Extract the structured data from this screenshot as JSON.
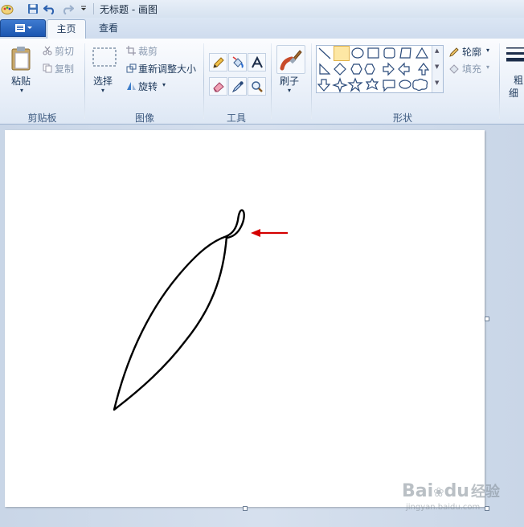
{
  "window": {
    "title": "无标题 - 画图"
  },
  "tabs": [
    {
      "label": "主页",
      "active": true
    },
    {
      "label": "查看",
      "active": false
    }
  ],
  "ribbon": {
    "clipboard": {
      "paste": "粘贴",
      "cut": "剪切",
      "copy": "复制",
      "group": "剪贴板"
    },
    "image": {
      "select": "选择",
      "crop": "裁剪",
      "resize": "重新调整大小",
      "rotate": "旋转",
      "group": "图像"
    },
    "tools": {
      "group": "工具"
    },
    "brushes": {
      "label": "刷子"
    },
    "shapes": {
      "outline": "轮廓",
      "fill": "填充",
      "group": "形状"
    },
    "size": {
      "label_top": "粗",
      "label_bottom": "细"
    }
  },
  "colors": {
    "accent": "#1a55b0",
    "arrow": "#d40000",
    "selected_shape": "#fde7a4"
  },
  "watermark": {
    "brand_bai": "Bai",
    "brand_du": "du",
    "brand_jy": "经验",
    "url": "jingyan.baidu.com"
  }
}
